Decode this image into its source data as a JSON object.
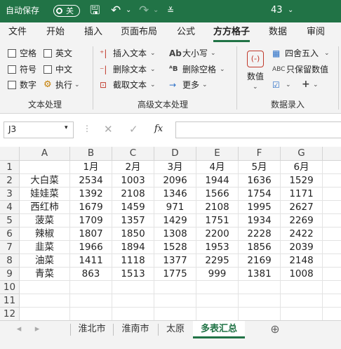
{
  "titlebar": {
    "autosave_label": "自动保存",
    "autosave_state": "关",
    "filename": "43"
  },
  "tabs": [
    "文件",
    "开始",
    "插入",
    "页面布局",
    "公式",
    "方方格子",
    "数据",
    "审阅"
  ],
  "ribbon": {
    "checkboxes": [
      "空格",
      "英文",
      "符号",
      "中文",
      "数字"
    ],
    "execute_label": "执行",
    "group1_label": "文本处理",
    "insert_text": "插入文本",
    "delete_text": "删除文本",
    "extract_text": "截取文本",
    "case_label": "大小写",
    "remove_space": "删除空格",
    "more_label": "更多",
    "group2_label": "高级文本处理",
    "value_label": "数值",
    "round_label": "四舍五入",
    "keep_value": "只保留数值",
    "group3_label": "数据录入"
  },
  "formula": {
    "namebox": "J3",
    "fx_label": "fx",
    "value": ""
  },
  "grid": {
    "columns": [
      "",
      "A",
      "B",
      "C",
      "D",
      "E",
      "F",
      "G"
    ],
    "rows": [
      [
        "1",
        "",
        "1月",
        "2月",
        "3月",
        "4月",
        "5月",
        "6月"
      ],
      [
        "2",
        "大白菜",
        "2534",
        "1003",
        "2096",
        "1944",
        "1636",
        "1529"
      ],
      [
        "3",
        "娃娃菜",
        "1392",
        "2108",
        "1346",
        "1566",
        "1754",
        "1171"
      ],
      [
        "4",
        "西红柿",
        "1679",
        "1459",
        "971",
        "2108",
        "1995",
        "2627"
      ],
      [
        "5",
        "菠菜",
        "1709",
        "1357",
        "1429",
        "1751",
        "1934",
        "2269"
      ],
      [
        "6",
        "辣椒",
        "1807",
        "1850",
        "1308",
        "2200",
        "2228",
        "2422"
      ],
      [
        "7",
        "韭菜",
        "1966",
        "1894",
        "1528",
        "1953",
        "1856",
        "2039"
      ],
      [
        "8",
        "油菜",
        "1411",
        "1118",
        "1377",
        "2295",
        "2169",
        "2148"
      ],
      [
        "9",
        "青菜",
        "863",
        "1513",
        "1775",
        "999",
        "1381",
        "1008"
      ],
      [
        "10",
        "",
        "",
        "",
        "",
        "",
        "",
        ""
      ],
      [
        "11",
        "",
        "",
        "",
        "",
        "",
        "",
        ""
      ],
      [
        "12",
        "",
        "",
        "",
        "",
        "",
        "",
        ""
      ]
    ]
  },
  "sheets": [
    "淮北市",
    "淮南市",
    "太原",
    "多表汇总"
  ],
  "active_sheet": "多表汇总",
  "accent": "#217346"
}
